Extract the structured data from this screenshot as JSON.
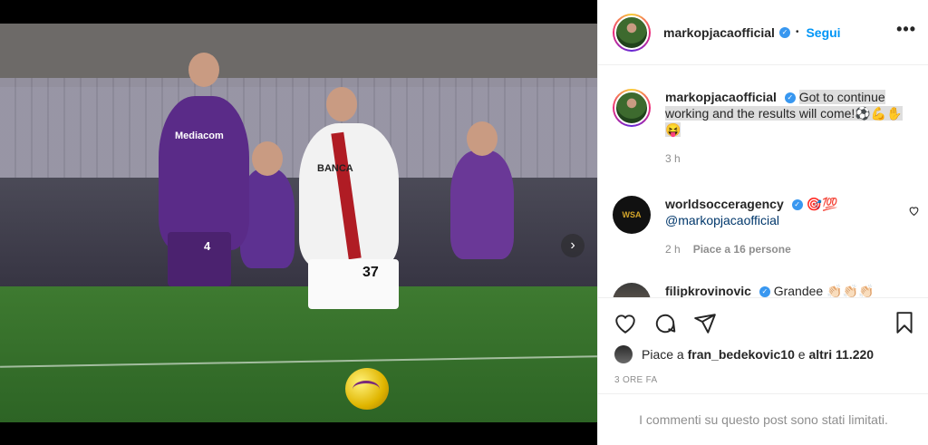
{
  "post": {
    "username": "markopjacaofficial",
    "follow_label": "Segui",
    "more_label": "•••"
  },
  "caption": {
    "username": "markopjacaofficial",
    "text": "Got to continue working and the results will come!⚽️💪✋😝",
    "time": "3 h"
  },
  "comments": [
    {
      "username": "worldsocceragency",
      "emoji": "🎯💯",
      "mention": "@markopjacaofficial",
      "time": "2 h",
      "likes": "Piace a 16 persone",
      "avatar_text": "WSA"
    },
    {
      "username": "filipkrovinovic",
      "text": "Grandee 👏🏻👏🏻👏🏻"
    }
  ],
  "likes": {
    "prefix": "Piace a",
    "user": "fran_bedekovic10",
    "connector": "e",
    "others": "altri 11.220"
  },
  "timestamp": "3 ORE FA",
  "comments_limited": "I commenti su questo post sono stati limitati.",
  "media": {
    "jersey_sponsor_left": "Mediacom",
    "jersey_sponsor_right": "BANCA",
    "jersey_number_left": "4",
    "jersey_number_right": "37",
    "carousel_dots": 2,
    "active_dot": 0
  },
  "colors": {
    "accent": "#0095f6",
    "verified": "#3897f0",
    "text": "#262626",
    "muted": "#8e8e8e"
  },
  "icons": [
    "like-icon",
    "comment-icon",
    "share-icon",
    "save-icon",
    "verified-icon",
    "next-arrow-icon",
    "more-options-icon"
  ]
}
